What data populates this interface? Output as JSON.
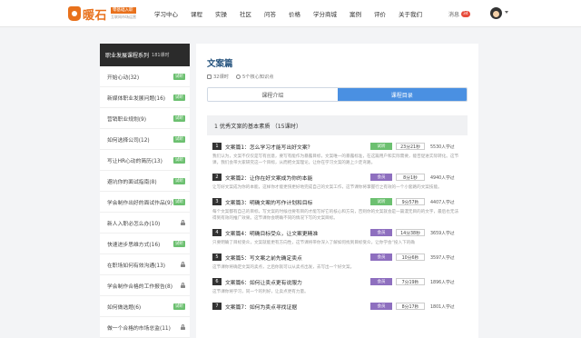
{
  "header": {
    "logo_text": "暖石",
    "logo_tag1": "零基础入职",
    "logo_tag2": "互联网市场运营",
    "nav": [
      "学习中心",
      "课程",
      "实操",
      "社区",
      "问答",
      "价格",
      "学分商城",
      "案例",
      "评价",
      "关于我们"
    ],
    "messages_label": "消息",
    "messages_count": "34"
  },
  "sidebar": {
    "title": "职业发展课程系列",
    "count": "181课时",
    "items": [
      {
        "label": "开始心动(32)",
        "state": "free"
      },
      {
        "label": "新媒体职业发展问题(16)",
        "state": "free"
      },
      {
        "label": "营销职业规划(9)",
        "state": "free"
      },
      {
        "label": "如何选择公司(12)",
        "state": "free"
      },
      {
        "label": "写让HR心动的简历(13)",
        "state": "free"
      },
      {
        "label": "避坑你的面试指南(8)",
        "state": "free"
      },
      {
        "label": "学会制作出好的面试作品(9)",
        "state": "free"
      },
      {
        "label": "新人入职必怎么办(10)",
        "state": "locked"
      },
      {
        "label": "快速进步思维方式(16)",
        "state": "free"
      },
      {
        "label": "在职场如何有效沟通(13)",
        "state": "locked"
      },
      {
        "label": "学会制作合格的工作报告(8)",
        "state": "locked"
      },
      {
        "label": "如何做选题(6)",
        "state": "free"
      },
      {
        "label": "做一个合格的市场总监(11)",
        "state": "locked"
      }
    ],
    "free_label": "试听"
  },
  "main": {
    "title": "文案篇",
    "meta_lessons": "32课时",
    "meta_points": "5个核心知识点",
    "tab_intro": "课程介绍",
    "tab_catalog": "课程目录",
    "chapter": "1 优秀文案的基本素质 （15课时）",
    "lessons": [
      {
        "num": "1",
        "title": "文案篇1：怎么学习才能写出好文案？",
        "badge": "试听",
        "type": "free",
        "duration": "23分21秒",
        "learners": "5530人学过",
        "desc": "我们认为，文案不仅仅是写有创意，要写有能作为暴露目标，文案唯一的暴露标准，在这篇用户和实际需要，能否促进实际转化。这节课，我们会带大家研究这一个目标，从而把文案理论，让你在学习文案的路上少走弯路。"
      },
      {
        "num": "2",
        "title": "文案篇2：让你在好文案成为你的本能",
        "badge": "会员",
        "type": "vip",
        "duration": "8分1秒",
        "learners": "4940人学过",
        "desc": "让写好文案成为你的本能，这样你才能更快更好地完成自己的文案工作，这节课你将掌握行之有效的一个小套路的文案技能。"
      },
      {
        "num": "3",
        "title": "文案篇3：明确文案的写作计划和目标",
        "badge": "试听",
        "type": "free",
        "duration": "9分57秒",
        "learners": "4407人学过",
        "desc": "每个文案都有自己的目标，写文案的时候也要有目的才能写好它的核心和方向，否则你的文案就会是一篇漫无目的的文字，最后也无法得到有效的推广效果。这节课你会明确不同的情况下写的文案目标。"
      },
      {
        "num": "4",
        "title": "文案篇4：明确目标受众，让文案更精准",
        "badge": "会员",
        "type": "vip",
        "duration": "14分38秒",
        "learners": "3659人学过",
        "desc": "只要明确了目标受众，文案就能更有方向性，这节课将带你深入了解如何找到目标受众，让你学会“投入下的确"
      },
      {
        "num": "5",
        "title": "文案篇5：写文案之前先确定卖点",
        "badge": "会员",
        "type": "vip",
        "duration": "10分6秒",
        "learners": "3597人学过",
        "desc": "这节课你将确定文案的卖点，之后你就可以从卖点出发，去写出一个好文案。"
      },
      {
        "num": "6",
        "title": "文案篇6：如何让卖点更有说服力",
        "badge": "会员",
        "type": "vip",
        "duration": "7分19秒",
        "learners": "1896人学过",
        "desc": "这节课你将学习，同一个的利好，让卖点更有力量。"
      },
      {
        "num": "7",
        "title": "文案篇7：如何为卖点寻找证据",
        "badge": "会员",
        "type": "vip",
        "duration": "8分17秒",
        "learners": "1801人学过",
        "desc": ""
      }
    ]
  }
}
